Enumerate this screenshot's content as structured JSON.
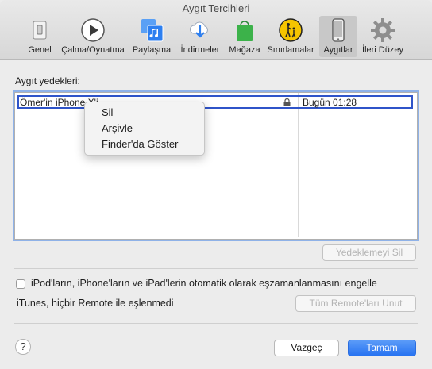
{
  "window": {
    "title": "Aygıt Tercihleri"
  },
  "tabs": [
    {
      "label": "Genel",
      "icon": "switch-icon"
    },
    {
      "label": "Çalma/Oynatma",
      "icon": "play-icon"
    },
    {
      "label": "Paylaşma",
      "icon": "music-share-icon"
    },
    {
      "label": "İndirmeler",
      "icon": "cloud-download-icon"
    },
    {
      "label": "Mağaza",
      "icon": "shopping-bag-icon"
    },
    {
      "label": "Sınırlamalar",
      "icon": "parental-controls-icon"
    },
    {
      "label": "Aygıtlar",
      "icon": "iphone-icon",
      "active": true
    },
    {
      "label": "İleri Düzey",
      "icon": "gear-icon"
    }
  ],
  "backups": {
    "label": "Aygıt yedekleri:",
    "rows": [
      {
        "name": "Ömer'in iPhone X'i",
        "date": "Bugün 01:28",
        "locked": true
      }
    ],
    "delete_button": "Yedeklemeyi Sil"
  },
  "context_menu": {
    "items": [
      "Sil",
      "Arşivle",
      "Finder'da Göster"
    ]
  },
  "sync": {
    "checkbox_label": "iPod'ların, iPhone'ların ve iPad'lerin otomatik olarak eşzamanlanmasını engelle",
    "checked": false
  },
  "remote": {
    "status": "iTunes, hiçbir Remote ile eşlenmedi",
    "unpair_button": "Tüm Remote'ları Unut"
  },
  "footer": {
    "help": "?",
    "cancel": "Vazgeç",
    "ok": "Tamam"
  },
  "colors": {
    "accent": "#2f6fe4",
    "selection_border": "#2f54c9"
  }
}
